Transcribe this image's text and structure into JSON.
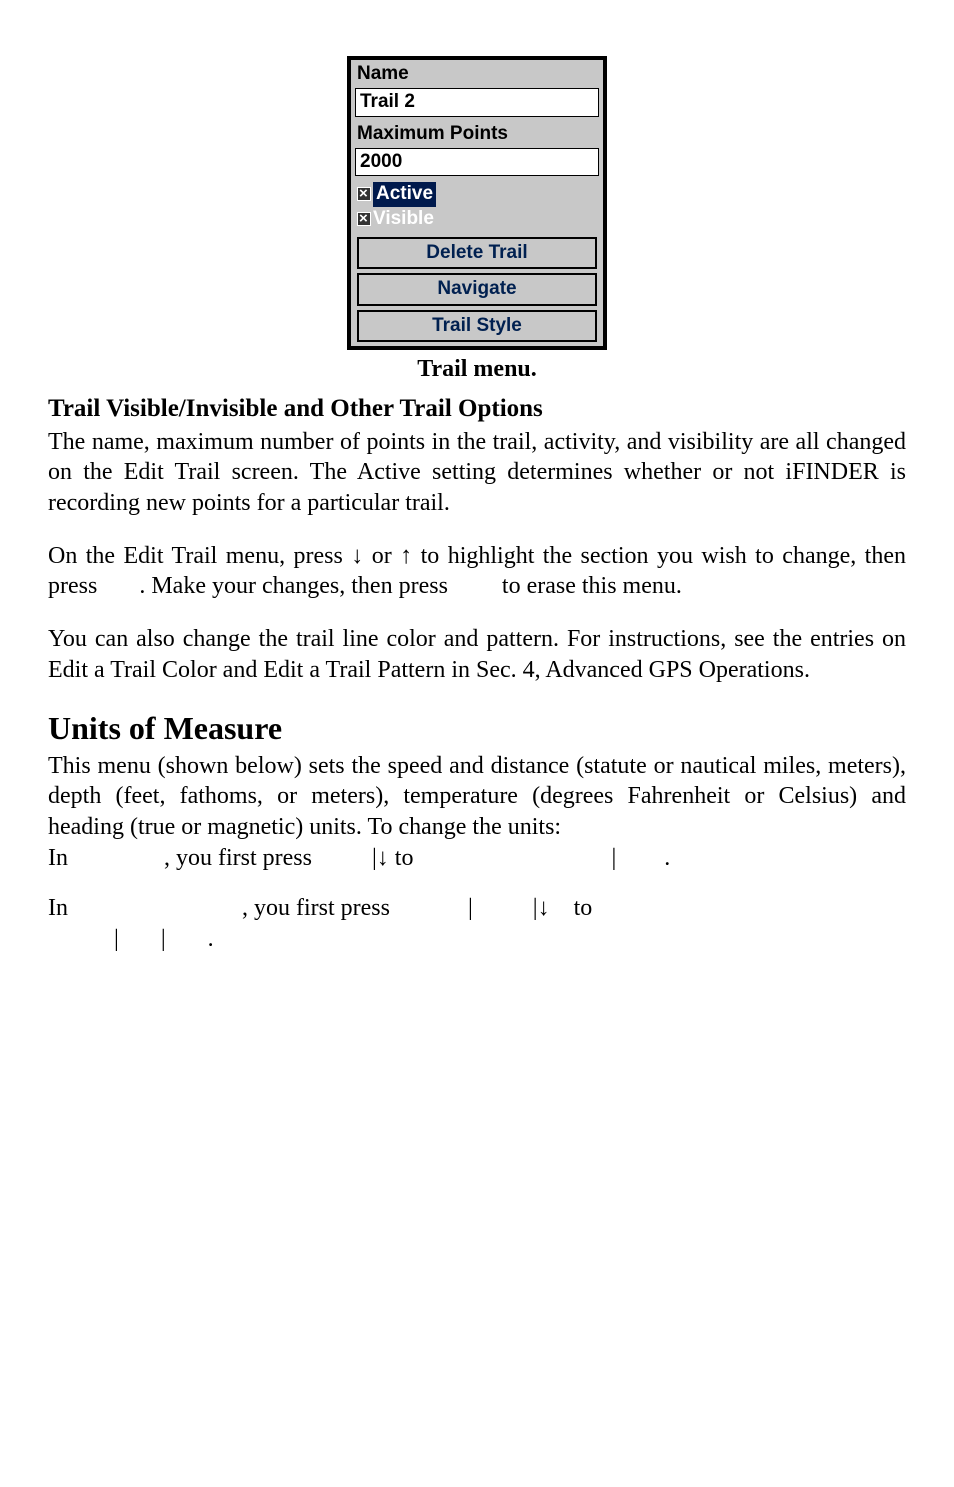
{
  "screenshot": {
    "name_label": "Name",
    "name_value": "Trail 2",
    "maxpts_label": "Maximum Points",
    "maxpts_value": "2000",
    "active_label": "Active",
    "visible_label": "Visible",
    "btn_delete": "Delete Trail",
    "btn_navigate": "Navigate",
    "btn_style": "Trail Style"
  },
  "caption": "Trail menu.",
  "subhead": "Trail Visible/Invisible and Other Trail Options",
  "para1": "The name, maximum number of points in the trail, activity, and visibility are all changed on the Edit Trail screen. The Active setting determines whether or not iFINDER is recording new points for a particular trail.",
  "para2_a": "On the Edit Trail menu, press ",
  "para2_b": " or ",
  "para2_c": " to highlight the section you wish to change, then press ",
  "para2_d": ". Make your changes, then press ",
  "para2_e": " to erase this menu.",
  "para3": "You can also change the trail line color and pattern. For instructions, see the entries on Edit a Trail Color and Edit a Trail Pattern in Sec. 4, Advanced GPS Operations.",
  "section_title": "Units of Measure",
  "para4": "This menu (shown below) sets the speed and distance (statute or nautical miles, meters), depth (feet, fathoms, or meters), temperature (degrees Fahrenheit or Celsius) and heading (true or magnetic) units. To change the units:",
  "step1_a": "In ",
  "step1_b": ", you first press ",
  "step1_c": " to ",
  "step2_a": "In ",
  "step2_b": ", you first press ",
  "step2_c": " to ",
  "arrow_down": "↓",
  "arrow_up": "↑",
  "pipe": "|",
  "dot": "."
}
